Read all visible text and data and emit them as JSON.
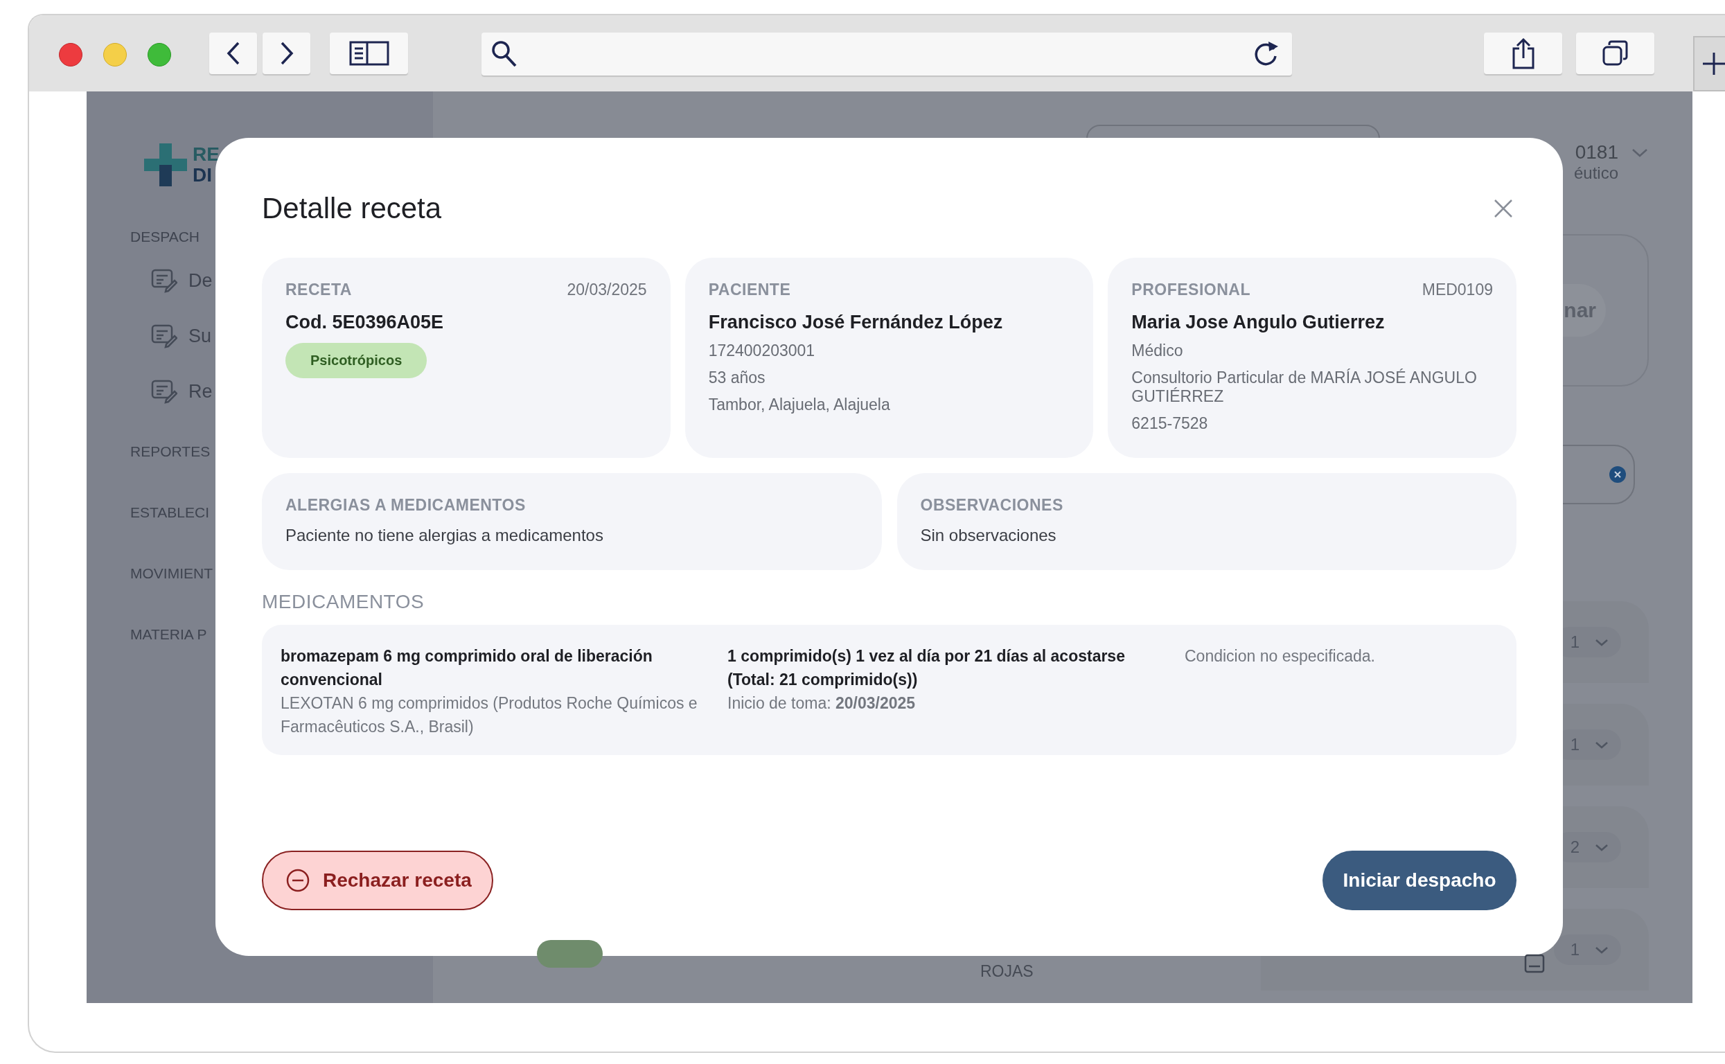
{
  "background": {
    "logo_text": [
      "RE",
      "DI"
    ],
    "sidebar": [
      {
        "label": "DESPACH",
        "items": [
          {
            "label": "De"
          },
          {
            "label": "Su"
          },
          {
            "label": "Re"
          }
        ]
      },
      {
        "label": "REPORTES"
      },
      {
        "label": "ESTABLECI"
      },
      {
        "label": "MOVIMIENT"
      },
      {
        "label": "MATERIA P"
      }
    ],
    "user": {
      "code": "0181",
      "role": "éutico"
    },
    "action_button": "nar",
    "rows": [
      {
        "quantity": "1"
      },
      {
        "quantity": "1"
      },
      {
        "quantity": "2"
      },
      {
        "quantity": "1"
      }
    ],
    "bottom_text": "ROJAS"
  },
  "modal": {
    "title": "Detalle receta",
    "cards": [
      {
        "kind": "receta",
        "label": "RECETA",
        "aside": "20/03/2025",
        "title": "Cod. 5E0396A05E",
        "badge": "Psicotrópicos"
      },
      {
        "kind": "person",
        "label": "PACIENTE",
        "title": "Francisco José Fernández López",
        "lines": [
          "172400203001",
          "53 años",
          "Tambor, Alajuela, Alajuela"
        ]
      },
      {
        "kind": "person",
        "label": "PROFESIONAL",
        "aside": "MED0109",
        "title": "Maria Jose Angulo Gutierrez",
        "lines": [
          "Médico",
          "Consultorio Particular de MARÍA JOSÉ ANGULO GUTIÉRREZ",
          "6215-7528"
        ]
      }
    ],
    "notes": [
      {
        "label": "ALERGIAS A MEDICAMENTOS",
        "text": "Paciente no tiene alergias a medicamentos"
      },
      {
        "label": "OBSERVACIONES",
        "text": "Sin observaciones"
      }
    ],
    "medications_label": "MEDICAMENTOS",
    "medications": [
      {
        "name": "bromazepam 6 mg comprimido oral de liberación convencional",
        "brand": "LEXOTAN 6 mg comprimidos (Produtos Roche Químicos e Farmacêuticos S.A., Brasil)",
        "dosage": "1 comprimido(s) 1 vez al día por 21 días al acostarse (Total: 21 comprimido(s))",
        "start": "Inicio de toma: **20/03/2025**",
        "condition": "Condicion no especificada."
      }
    ],
    "buttons": [
      {
        "kind": "reject",
        "label": "Rechazar receta"
      },
      {
        "kind": "primary",
        "label": "Iniciar despacho"
      }
    ]
  }
}
